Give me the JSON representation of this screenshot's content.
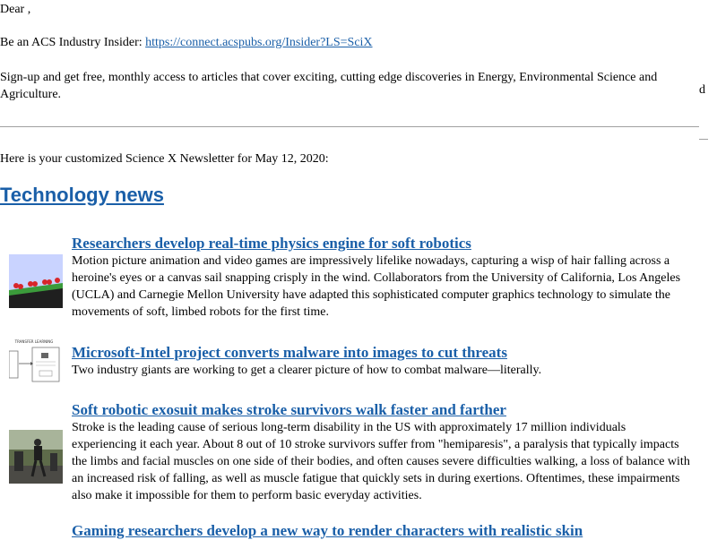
{
  "greeting": "Dear ,",
  "insider": {
    "prefix": "Be an ACS Industry Insider: ",
    "link_text": "https://connect.acspubs.org/Insider?LS=SciX"
  },
  "signup_text": "Sign-up and get free, monthly access to articles that cover exciting, cutting edge discoveries in Energy, Environmental Science and Agriculture.",
  "stray_char": "d",
  "intro_text": "Here is your customized Science X Newsletter for May 12, 2020:",
  "section_heading": "Technology news",
  "articles": [
    {
      "title": "Researchers develop real-time physics engine for soft robotics",
      "summary": "Motion picture animation and video games are impressively lifelike nowadays, capturing a wisp of hair falling across a heroine's eyes or a canvas sail snapping crisply in the wind. Collaborators from the University of California, Los Angeles (UCLA) and Carnegie Mellon University have adapted this sophisticated computer graphics technology to simulate the movements of soft, limbed robots for the first time."
    },
    {
      "title": "Microsoft-Intel project converts malware into images to cut threats",
      "summary": "Two industry giants are working to get a clearer picture of how to combat malware—literally."
    },
    {
      "title": "Soft robotic exosuit makes stroke survivors walk faster and farther",
      "summary": "Stroke is the leading cause of serious long-term disability in the US with approximately 17 million individuals experiencing it each year. About 8 out of 10 stroke survivors suffer from \"hemiparesis\", a paralysis that typically impacts the limbs and facial muscles on one side of their bodies, and often causes severe difficulties walking, a loss of balance with an increased risk of falling, as well as muscle fatigue that quickly sets in during exertions. Oftentimes, these impairments also make it impossible for them to perform basic everyday activities."
    },
    {
      "title": "Gaming researchers develop a new way to render characters with realistic skin",
      "summary": ""
    }
  ],
  "thumb2_text": "TRANSFER LEARNING",
  "colors": {
    "link": "#1a5fa8",
    "rule": "#a0a0a0"
  }
}
